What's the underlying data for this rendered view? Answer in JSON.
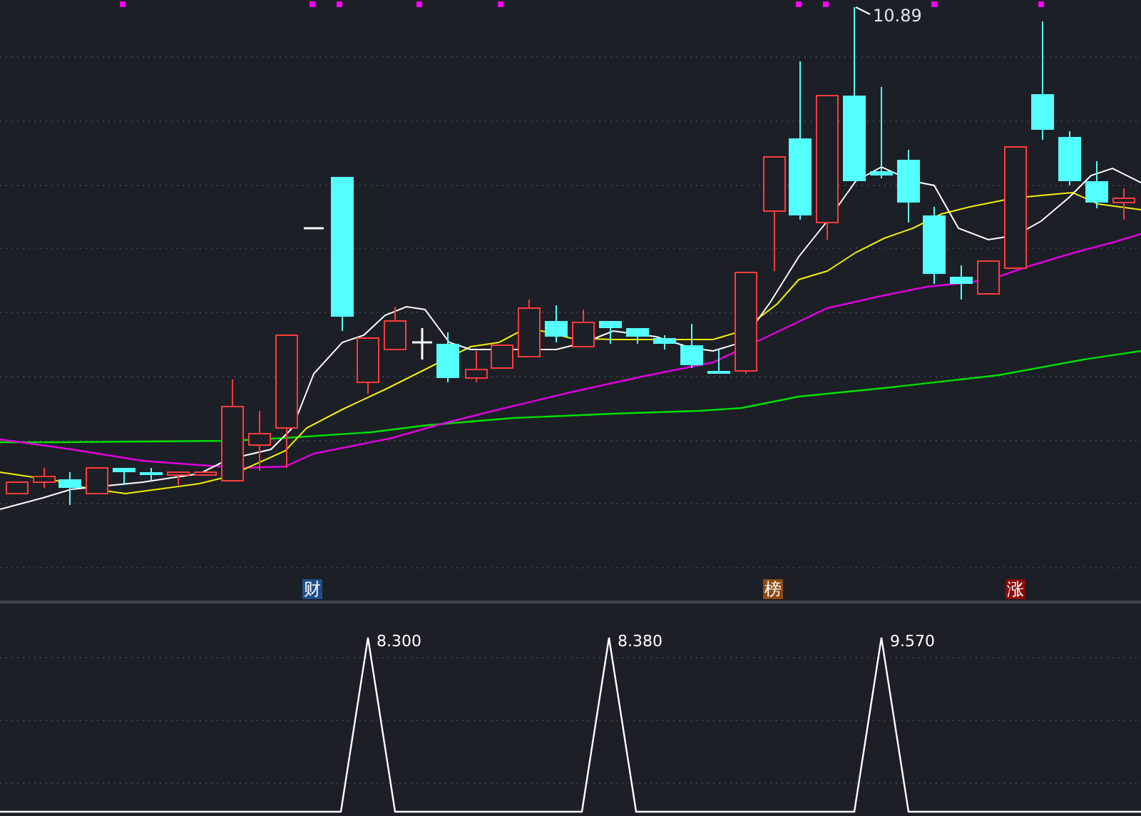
{
  "price_chart": {
    "high_label": "10.89",
    "tags": [
      {
        "label": "财",
        "color": "#1f4e8c"
      },
      {
        "label": "榜",
        "color": "#8b4a12"
      },
      {
        "label": "涨",
        "color": "#8b0a0a"
      }
    ]
  },
  "indicator_panel": {
    "peak_labels": [
      "8.300",
      "8.380",
      "9.570"
    ]
  }
}
